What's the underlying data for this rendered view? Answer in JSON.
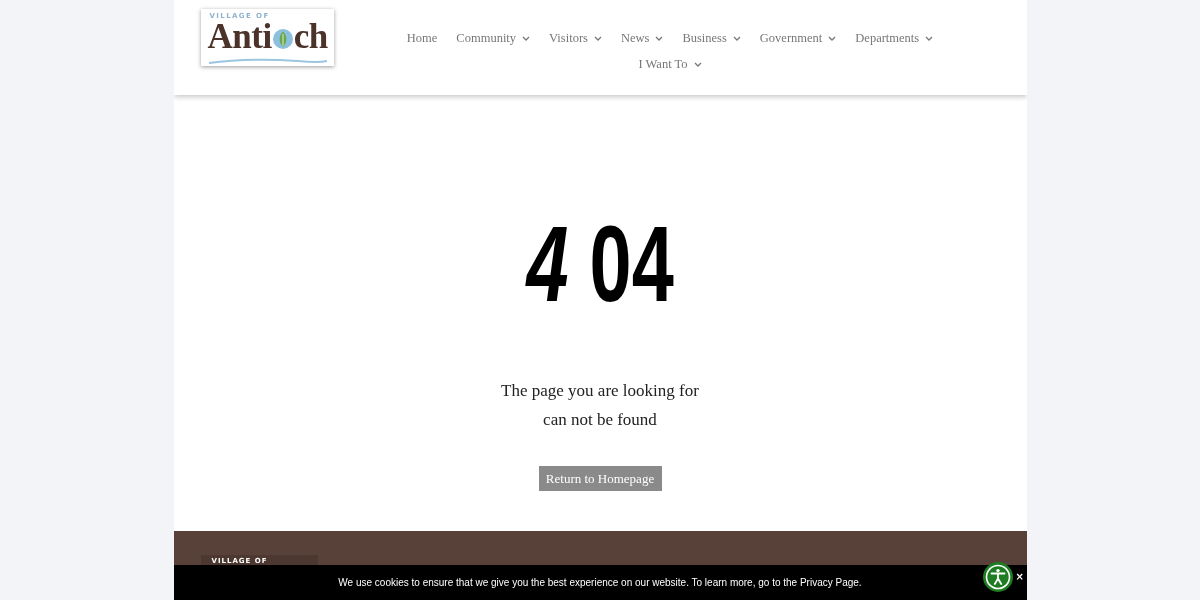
{
  "header": {
    "logo": {
      "tagline": "VILLAGE OF",
      "name_parts": [
        "Anti",
        "ch"
      ]
    },
    "nav": [
      {
        "label": "Home",
        "has_dropdown": false
      },
      {
        "label": "Community",
        "has_dropdown": true
      },
      {
        "label": "Visitors",
        "has_dropdown": true
      },
      {
        "label": "News",
        "has_dropdown": true
      },
      {
        "label": "Business",
        "has_dropdown": true
      },
      {
        "label": "Government",
        "has_dropdown": true
      },
      {
        "label": "Departments",
        "has_dropdown": true
      },
      {
        "label": "I Want To",
        "has_dropdown": true
      }
    ]
  },
  "main": {
    "error_code": "*4* 04",
    "message_lines": [
      "The page you are looking for",
      "can not be found"
    ],
    "button": "Return to Homepage"
  },
  "footer": {
    "logo": {
      "tagline": "VILLAGE OF"
    }
  },
  "cookie_banner": {
    "text": "We use cookies to ensure that we give you the best experience on our website. To learn more, go to the Privacy Page."
  },
  "accessibility_widget": {
    "close_label": "×"
  }
}
